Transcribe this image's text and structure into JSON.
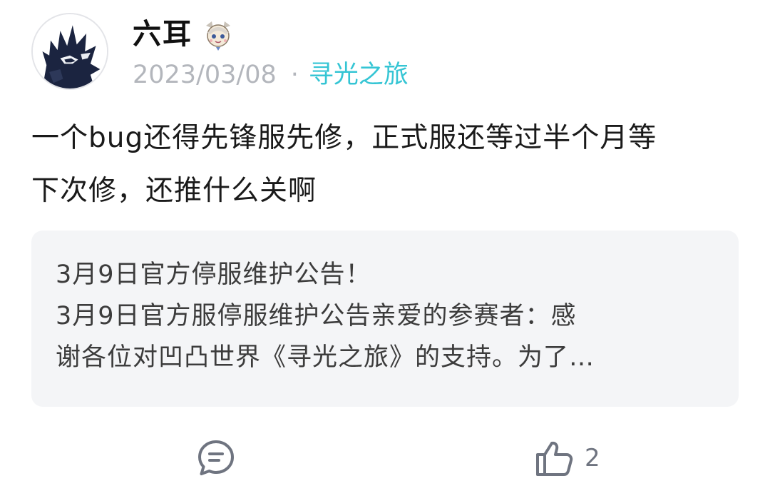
{
  "author": {
    "name": "六耳",
    "avatar_icon": "anime-avatar-icon",
    "badge_icon": "paimon-badge-icon"
  },
  "meta": {
    "date": "2023/03/08",
    "separator": "·",
    "topic": "寻光之旅"
  },
  "content": {
    "lines": [
      "一个bug还得先锋服先修，正式服还等过半个月等",
      "下次修，还推什么关啊"
    ]
  },
  "quote": {
    "lines": [
      "3月9日官方停服维护公告！",
      "3月9日官方服停服维护公告亲爱的参赛者：感",
      "谢各位对凹凸世界《寻光之旅》的支持。为了…"
    ]
  },
  "actions": {
    "comment_icon": "comment-icon",
    "like_icon": "thumbs-up-icon",
    "like_count": "2"
  },
  "colors": {
    "accent": "#35c5d4",
    "muted": "#b3b6bc",
    "card_bg": "#f4f5f7"
  }
}
